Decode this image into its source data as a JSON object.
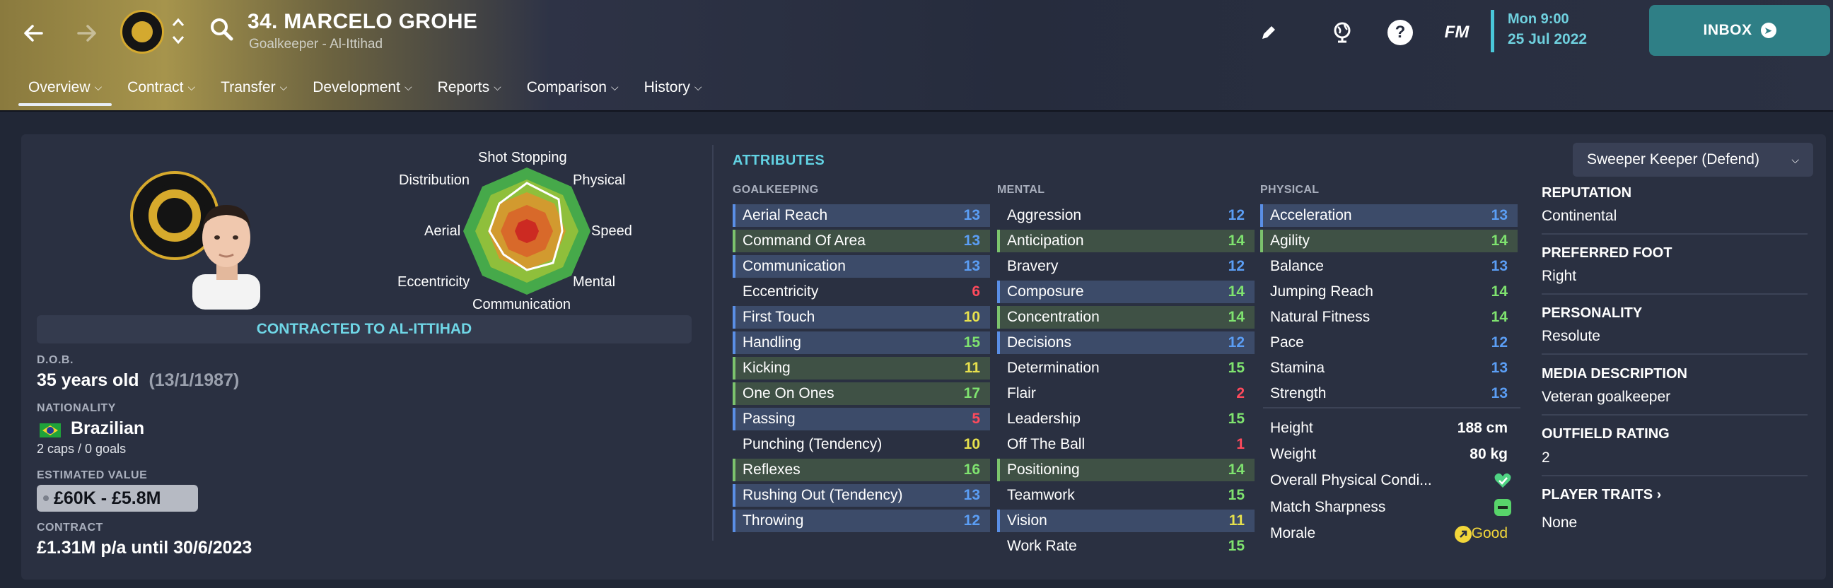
{
  "header": {
    "player_title": "34. MARCELO GROHE",
    "player_subtitle": "Goalkeeper - Al-Ittihad",
    "date_time": "Mon 9:00",
    "date": "25 Jul 2022",
    "inbox_label": "INBOX",
    "fm_label": "FM",
    "help_label": "?",
    "tabs": [
      {
        "label": "Overview"
      },
      {
        "label": "Contract"
      },
      {
        "label": "Transfer"
      },
      {
        "label": "Development"
      },
      {
        "label": "Reports"
      },
      {
        "label": "Comparison"
      },
      {
        "label": "History"
      }
    ]
  },
  "radar": {
    "labels": [
      "Shot Stopping",
      "Physical",
      "Speed",
      "Mental",
      "Communication",
      "Eccentricity",
      "Aerial",
      "Distribution"
    ]
  },
  "left": {
    "contract_banner": "CONTRACTED TO AL-ITTIHAD",
    "dob_label": "D.O.B.",
    "age": "35 years old",
    "dob": "(13/1/1987)",
    "nationality_label": "NATIONALITY",
    "nationality": "Brazilian",
    "caps": "2 caps / 0 goals",
    "value_label": "ESTIMATED VALUE",
    "value": "£60K - £5.8M",
    "contract_label": "CONTRACT",
    "contract": "£1.31M p/a until 30/6/2023"
  },
  "attributes": {
    "title": "ATTRIBUTES",
    "goalkeeping_head": "GOALKEEPING",
    "mental_head": "MENTAL",
    "physical_head": "PHYSICAL",
    "goalkeeping": [
      {
        "name": "Aerial Reach",
        "value": "13"
      },
      {
        "name": "Command Of Area",
        "value": "13"
      },
      {
        "name": "Communication",
        "value": "13"
      },
      {
        "name": "Eccentricity",
        "value": "6"
      },
      {
        "name": "First Touch",
        "value": "10"
      },
      {
        "name": "Handling",
        "value": "15"
      },
      {
        "name": "Kicking",
        "value": "11"
      },
      {
        "name": "One On Ones",
        "value": "17"
      },
      {
        "name": "Passing",
        "value": "5"
      },
      {
        "name": "Punching (Tendency)",
        "value": "10"
      },
      {
        "name": "Reflexes",
        "value": "16"
      },
      {
        "name": "Rushing Out (Tendency)",
        "value": "13"
      },
      {
        "name": "Throwing",
        "value": "12"
      }
    ],
    "mental": [
      {
        "name": "Aggression",
        "value": "12"
      },
      {
        "name": "Anticipation",
        "value": "14"
      },
      {
        "name": "Bravery",
        "value": "12"
      },
      {
        "name": "Composure",
        "value": "14"
      },
      {
        "name": "Concentration",
        "value": "14"
      },
      {
        "name": "Decisions",
        "value": "12"
      },
      {
        "name": "Determination",
        "value": "15"
      },
      {
        "name": "Flair",
        "value": "2"
      },
      {
        "name": "Leadership",
        "value": "15"
      },
      {
        "name": "Off The Ball",
        "value": "1"
      },
      {
        "name": "Positioning",
        "value": "14"
      },
      {
        "name": "Teamwork",
        "value": "15"
      },
      {
        "name": "Vision",
        "value": "11"
      },
      {
        "name": "Work Rate",
        "value": "15"
      }
    ],
    "physical": [
      {
        "name": "Acceleration",
        "value": "13"
      },
      {
        "name": "Agility",
        "value": "14"
      },
      {
        "name": "Balance",
        "value": "13"
      },
      {
        "name": "Jumping Reach",
        "value": "14"
      },
      {
        "name": "Natural Fitness",
        "value": "14"
      },
      {
        "name": "Pace",
        "value": "12"
      },
      {
        "name": "Stamina",
        "value": "13"
      },
      {
        "name": "Strength",
        "value": "13"
      }
    ],
    "extra": {
      "height_label": "Height",
      "height": "188 cm",
      "weight_label": "Weight",
      "weight": "80 kg",
      "condition_label": "Overall Physical Condi...",
      "sharpness_label": "Match Sharpness",
      "morale_label": "Morale",
      "morale": "Good"
    }
  },
  "right": {
    "role": "Sweeper Keeper (Defend)",
    "reputation_label": "REPUTATION",
    "reputation": "Continental",
    "foot_label": "PREFERRED FOOT",
    "foot": "Right",
    "personality_label": "PERSONALITY",
    "personality": "Resolute",
    "media_label": "MEDIA DESCRIPTION",
    "media": "Veteran goalkeeper",
    "outfield_label": "OUTFIELD RATING",
    "outfield": "2",
    "traits_label": "PLAYER TRAITS",
    "traits": "None"
  },
  "colors": {
    "accent": "#62d2e3",
    "inbox": "#2f7f86",
    "club_gold": "#d7aa2c"
  }
}
